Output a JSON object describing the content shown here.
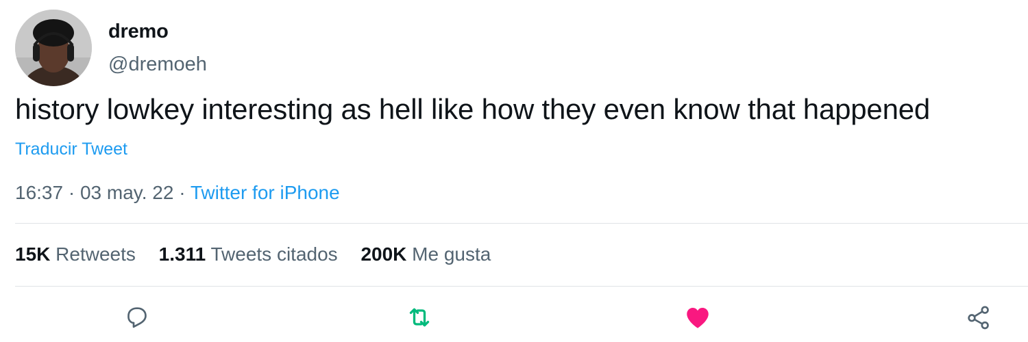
{
  "tweet": {
    "display_name": "dremo",
    "handle": "@dremoeh",
    "text": "history lowkey interesting as hell like how they even know that happened",
    "translate_label": "Traducir Tweet",
    "time": "16:37",
    "date": "03 may. 22",
    "separator": "·",
    "source": "Twitter for iPhone"
  },
  "stats": {
    "retweets_count": "15K",
    "retweets_label": "Retweets",
    "quotes_count": "1.311",
    "quotes_label": "Tweets citados",
    "likes_count": "200K",
    "likes_label": "Me gusta"
  },
  "actions": {
    "reply_icon": "reply-icon",
    "retweet_icon": "retweet-icon",
    "like_icon": "heart-icon",
    "share_icon": "share-icon"
  },
  "colors": {
    "link": "#1d9bf0",
    "secondary_text": "#536471",
    "primary_text": "#0f1419",
    "retweet_green": "#00ba7c",
    "like_pink": "#f91880",
    "divider": "#dfe3e6"
  }
}
